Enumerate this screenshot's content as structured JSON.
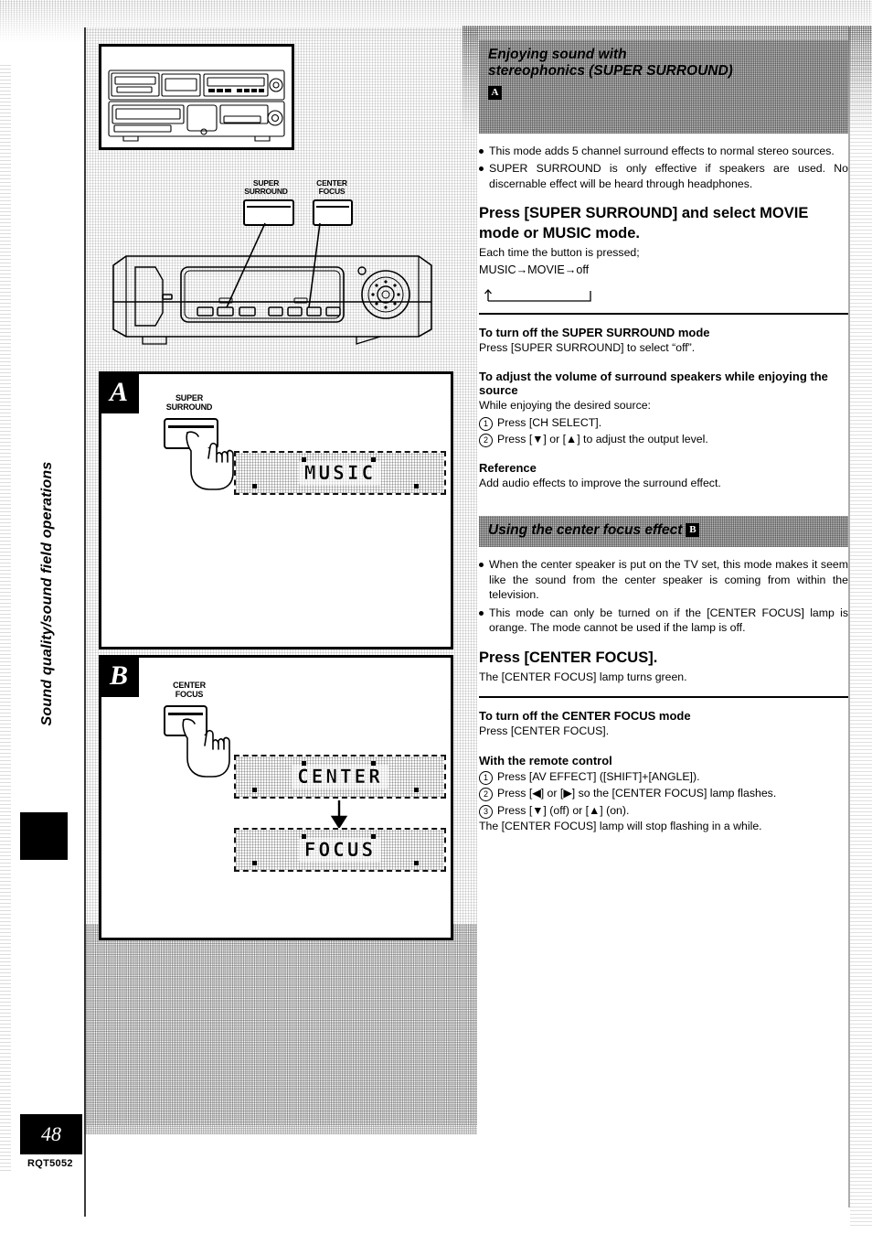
{
  "page": {
    "number": "48",
    "doc_code": "RQT5052",
    "side_tab": "Sound quality/sound field operations"
  },
  "illustrations": {
    "top_device_caption": "",
    "callouts": [
      {
        "name": "super-surround",
        "line1": "SUPER",
        "line2": "SURROUND"
      },
      {
        "name": "center-focus",
        "line1": "CENTER",
        "line2": "FOCUS"
      }
    ],
    "panel_a": {
      "badge": "A",
      "button_line1": "SUPER",
      "button_line2": "SURROUND",
      "display": "MUSIC"
    },
    "panel_b": {
      "badge": "B",
      "button_line1": "CENTER",
      "button_line2": "FOCUS",
      "display_1": "CENTER",
      "display_2": "FOCUS"
    }
  },
  "sections": [
    {
      "id": "super-surround",
      "heading_line1": "Enjoying sound with",
      "heading_line2": "stereophonics (SUPER SURROUND)",
      "heading_badge": "A",
      "bullets": [
        "This mode adds 5 channel surround effects to normal stereo sources.",
        "SUPER SURROUND is only effective if speakers are used. No discernable effect will be heard through headphones."
      ],
      "instruction": "Press [SUPER SURROUND] and select MOVIE mode or MUSIC mode.",
      "each_time": "Each time the button is pressed;",
      "cycle": "MUSIC→MOVIE→off",
      "turn_off_head": "To turn off the SUPER SURROUND mode",
      "turn_off_body": "Press [SUPER SURROUND] to select “off”.",
      "adjust_head": "To adjust the volume of surround speakers while enjoying the source",
      "adjust_intro": "While enjoying the desired source:",
      "adjust_steps": [
        "Press [CH SELECT].",
        "Press [▼] or [▲] to adjust the output level."
      ],
      "reference_head": "Reference",
      "reference_body": "Add audio effects to improve the surround effect."
    },
    {
      "id": "center-focus",
      "heading_line1": "Using the center focus effect",
      "heading_badge": "B",
      "bullets": [
        "When the center speaker is put on the TV set, this mode makes it seem like the sound from the center speaker is coming from within the television.",
        "This mode can only be turned on if the [CENTER FOCUS] lamp is orange. The mode cannot be used if the lamp is off."
      ],
      "instruction": "Press [CENTER FOCUS].",
      "instruction_body": "The [CENTER FOCUS] lamp turns green.",
      "turn_off_head": "To turn off the CENTER FOCUS mode",
      "turn_off_body": "Press [CENTER FOCUS].",
      "remote_head": "With the remote control",
      "remote_steps": [
        "Press [AV EFFECT] ([SHIFT]+[ANGLE]).",
        "Press [◀] or [▶] so the [CENTER FOCUS] lamp flashes.",
        "Press [▼] (off) or [▲] (on)."
      ],
      "remote_note": "The [CENTER FOCUS] lamp will stop flashing in a while."
    }
  ]
}
